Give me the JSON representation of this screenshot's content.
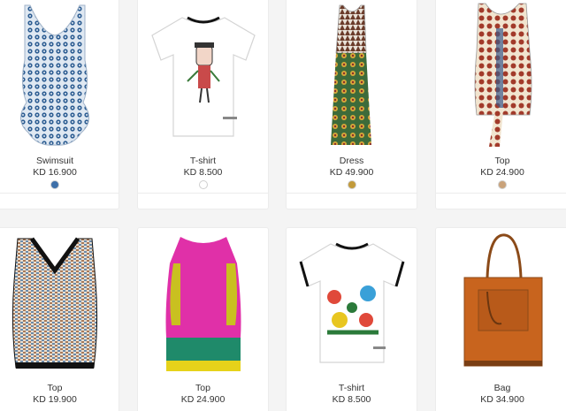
{
  "products": [
    {
      "name": "Swimsuit",
      "price": "KD 16.900",
      "swatch": "#3d6fa8",
      "icon": "swimsuit-icon"
    },
    {
      "name": "T-shirt",
      "price": "KD 8.500",
      "swatch": "#ffffff",
      "icon": "tshirt-icon"
    },
    {
      "name": "Dress",
      "price": "KD 49.900",
      "swatch": "#c29a3a",
      "icon": "dress-icon"
    },
    {
      "name": "Top",
      "price": "KD 24.900",
      "swatch": "#c9a27a",
      "icon": "top-icon"
    },
    {
      "name": "Top",
      "price": "KD 19.900",
      "swatch": "",
      "icon": "top-icon"
    },
    {
      "name": "Top",
      "price": "KD 24.900",
      "swatch": "",
      "icon": "top-icon"
    },
    {
      "name": "T-shirt",
      "price": "KD 8.500",
      "swatch": "",
      "icon": "tshirt-icon"
    },
    {
      "name": "Bag",
      "price": "KD 34.900",
      "swatch": "",
      "icon": "bag-icon"
    }
  ]
}
